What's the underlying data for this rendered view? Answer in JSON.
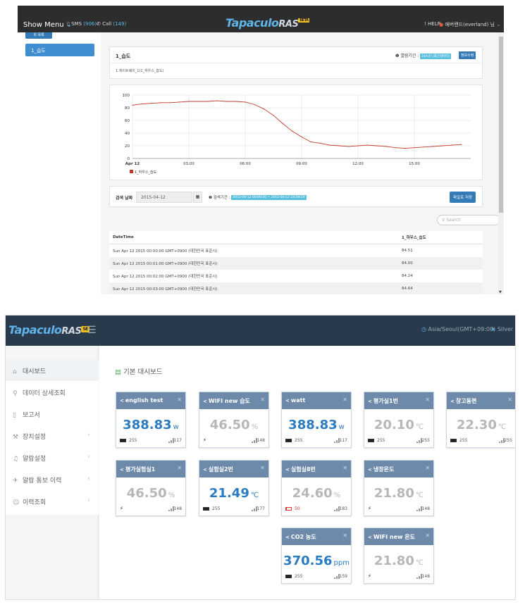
{
  "shot1": {
    "topbar": {
      "show_menu": "Show Menu",
      "sms_label": "SMS",
      "sms_count": "(906)",
      "call_label": "Call",
      "call_count": "(149)",
      "logo": "Tapaculo",
      "logo_suffix": "RAS",
      "logo_badge": "BETA",
      "help": "HELP",
      "user": "에버랜드(everland) 님"
    },
    "sidebar": {
      "top_button": "위 목록",
      "active_item": "1_습도"
    },
    "panel": {
      "title": "1_습도",
      "subtitle": "1.게이트웨이_1(1_하우스_습도)",
      "period_label": "열람기간 :",
      "period_tag": "24시간 (최근데이터)",
      "edit_button": "정보수정"
    },
    "legend": "1_하우스_습도",
    "search": {
      "label": "검색 날짜",
      "date": "2015-04-12",
      "range_label": "검색기간 :",
      "range_value": "2015-04-12 00:00:00 ~ 2015-04-12 23:59:59",
      "save_button": "파일로 저장",
      "placeholder": "Search"
    },
    "table": {
      "columns": [
        "DateTime",
        "1_하우스_습도"
      ],
      "rows": [
        [
          "Sun Apr 12 2015 00:00:00 GMT+0900 (대한민국 표준시)",
          "84.51"
        ],
        [
          "Sun Apr 12 2015 00:01:00 GMT+0900 (대한민국 표준시)",
          "84.00"
        ],
        [
          "Sun Apr 12 2015 00:02:00 GMT+0900 (대한민국 표준시)",
          "84.24"
        ],
        [
          "Sun Apr 12 2015 00:03:00 GMT+0900 (대한민국 표준시)",
          "84.64"
        ]
      ]
    }
  },
  "chart_data": {
    "type": "line",
    "x": [
      "00:00",
      "00:30",
      "01:00",
      "01:30",
      "02:00",
      "02:30",
      "03:00",
      "03:30",
      "04:00",
      "04:30",
      "05:00",
      "05:30",
      "06:00",
      "06:30",
      "07:00",
      "07:30",
      "08:00",
      "08:30",
      "09:00",
      "09:30",
      "10:00",
      "10:30",
      "11:00",
      "11:30",
      "12:00",
      "12:30",
      "13:00",
      "13:30",
      "14:00",
      "14:30",
      "15:00",
      "15:30",
      "16:00",
      "16:30",
      "17:00",
      "17:30"
    ],
    "series": [
      {
        "name": "1_하우스_습도",
        "values": [
          84,
          86,
          87,
          88,
          88,
          89,
          90,
          90,
          90,
          91,
          90,
          90,
          89,
          85,
          78,
          68,
          55,
          43,
          34,
          26,
          24,
          21,
          20,
          19,
          20,
          21,
          20,
          19,
          17,
          16,
          17,
          18,
          19,
          20,
          21,
          22
        ],
        "color": "#c0392b"
      }
    ],
    "xticks": [
      "Apr 12",
      "03:00",
      "06:00",
      "09:00",
      "12:00",
      "15:00"
    ],
    "yticks": [
      "0",
      "20",
      "40",
      "60",
      "80",
      "100"
    ],
    "ylim": [
      0,
      100
    ],
    "grid": true,
    "legend_position": "bottom-left"
  },
  "shot2": {
    "topbar": {
      "logo": "Tapaculo",
      "logo_suffix": "RAS",
      "logo_badge": "SE",
      "timezone": "Asia/Seoul(GMT+09:00)",
      "user": "Silver I"
    },
    "sidebar": [
      {
        "label": "대시보드",
        "icon": "home-icon",
        "glyph": "⌂",
        "has_chevron": false
      },
      {
        "label": "데이터 상세조회",
        "icon": "search-icon",
        "glyph": "⚲",
        "has_chevron": false
      },
      {
        "label": "보고서",
        "icon": "document-icon",
        "glyph": "▯",
        "has_chevron": false
      },
      {
        "label": "장치설정",
        "icon": "wrench-icon",
        "glyph": "⚒",
        "has_chevron": true
      },
      {
        "label": "알람설정",
        "icon": "bell-icon",
        "glyph": "♫",
        "has_chevron": true
      },
      {
        "label": "알람 통보 이력",
        "icon": "satellite-icon",
        "glyph": "✈",
        "has_chevron": true
      },
      {
        "label": "이력조회",
        "icon": "user-icon",
        "glyph": "☺",
        "has_chevron": true
      }
    ],
    "page_title": "기본 대시보드",
    "cards": [
      {
        "title": "english test",
        "value": "388.83",
        "unit": "w",
        "status": "live",
        "power": "battery",
        "battery": "255",
        "battery_level": 1.0,
        "battery_low": false,
        "signal": "117"
      },
      {
        "title": "WIFI new 습도",
        "value": "46.50",
        "unit": "%",
        "status": "stale",
        "power": "plug",
        "battery": "",
        "battery_level": 0,
        "battery_low": false,
        "signal": "148"
      },
      {
        "title": "watt",
        "value": "388.83",
        "unit": "w",
        "status": "live",
        "power": "battery",
        "battery": "255",
        "battery_level": 1.0,
        "battery_low": false,
        "signal": "117"
      },
      {
        "title": "평가실1번",
        "value": "20.10",
        "unit": "℃",
        "status": "stale",
        "power": "battery",
        "battery": "255",
        "battery_level": 1.0,
        "battery_low": false,
        "signal": "255"
      },
      {
        "title": "창고동편",
        "value": "22.30",
        "unit": "℃",
        "status": "stale",
        "power": "battery",
        "battery": "255",
        "battery_level": 1.0,
        "battery_low": false,
        "signal": "255"
      },
      {
        "title": "평가실험실1",
        "value": "46.50",
        "unit": "%",
        "status": "stale",
        "power": "plug",
        "battery": "",
        "battery_level": 0,
        "battery_low": false,
        "signal": "148"
      },
      {
        "title": "실험실2번",
        "value": "21.49",
        "unit": "℃",
        "status": "live",
        "power": "battery",
        "battery": "255",
        "battery_level": 1.0,
        "battery_low": false,
        "signal": "177"
      },
      {
        "title": "실험실8번",
        "value": "24.60",
        "unit": "%",
        "status": "stale",
        "power": "battery",
        "battery": "50",
        "battery_level": 0.2,
        "battery_low": true,
        "signal": "183"
      },
      {
        "title": "냉장온도",
        "value": "21.80",
        "unit": "℃",
        "status": "stale",
        "power": "plug",
        "battery": "",
        "battery_level": 0,
        "battery_low": false,
        "signal": "148"
      },
      {
        "title": "CO2 농도",
        "value": "370.56",
        "unit": "ppm",
        "status": "live",
        "power": "battery",
        "battery": "255",
        "battery_level": 1.0,
        "battery_low": false,
        "signal": "159"
      },
      {
        "title": "WIFI new 온도",
        "value": "21.80",
        "unit": "℃",
        "status": "stale",
        "power": "plug",
        "battery": "",
        "battery_level": 0,
        "battery_low": false,
        "signal": "148"
      }
    ]
  }
}
